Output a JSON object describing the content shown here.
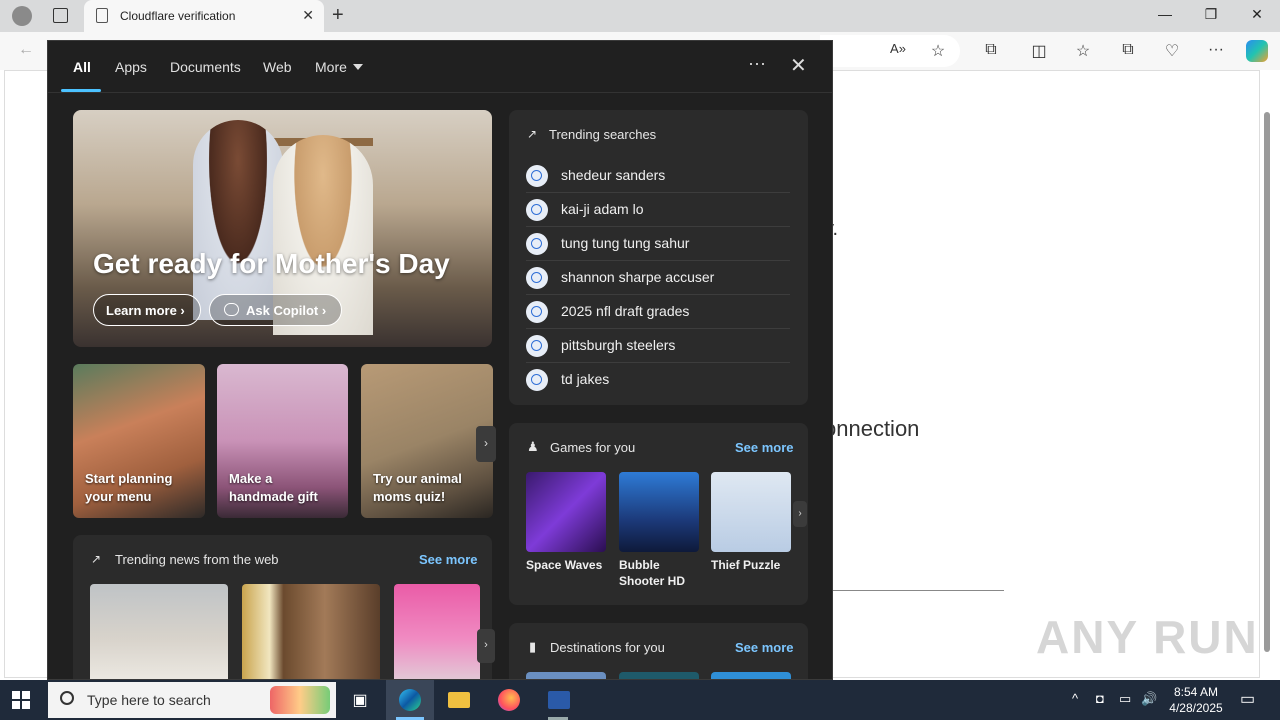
{
  "browser": {
    "tab_title": "Cloudflare verification",
    "tab_close": "✕",
    "new_tab": "+",
    "win_min": "—",
    "win_restore": "❐",
    "win_close": "✕",
    "nav_back": "←",
    "nav_read_aloud": "A»",
    "nav_favorite": "☆",
    "nav_extensions": "⧉",
    "nav_split": "◫",
    "nav_favorites": "☆",
    "nav_collections": "⧉",
    "nav_browser_essentials": "♡",
    "nav_menu": "···"
  },
  "page_behind": {
    "text1": "y.",
    "text2": "onnection",
    "watermark": "ANY RUN"
  },
  "panel": {
    "tabs": [
      {
        "label": "All"
      },
      {
        "label": "Apps"
      },
      {
        "label": "Documents"
      },
      {
        "label": "Web"
      },
      {
        "label": "More"
      }
    ],
    "ellipsis": "···",
    "close": "✕",
    "hero": {
      "title": "Get ready for Mother's Day",
      "learn_more": "Learn more ›",
      "ask_copilot": "Ask Copilot ›"
    },
    "cards": [
      {
        "label_line1": "Start planning",
        "label_line2": "your menu"
      },
      {
        "label_line1": "Make a",
        "label_line2": "handmade gift"
      },
      {
        "label_line1": "Try our animal",
        "label_line2": "moms quiz!"
      }
    ],
    "card_arrow": "›",
    "news": {
      "header": "Trending news from the web",
      "see_more": "See more",
      "arrow": "›"
    },
    "trending": {
      "header": "Trending searches",
      "items": [
        "shedeur sanders",
        "kai-ji adam lo",
        "tung tung tung sahur",
        "shannon sharpe accuser",
        "2025 nfl draft grades",
        "pittsburgh steelers",
        "td jakes"
      ]
    },
    "games": {
      "header": "Games for you",
      "see_more": "See more",
      "items": [
        {
          "name": "Space Waves"
        },
        {
          "name": "Bubble Shooter HD"
        },
        {
          "name": "Thief Puzzle"
        }
      ],
      "arrow": "›"
    },
    "destinations": {
      "header": "Destinations for you",
      "see_more": "See more"
    }
  },
  "taskbar": {
    "search_placeholder": "Type here to search",
    "time": "8:54 AM",
    "date": "4/28/2025",
    "tray_chevron": "^",
    "tray_volume": "🔊",
    "tray_notifications": "▭"
  },
  "colors": {
    "panel_bg": "#202020",
    "card_bg": "#2b2b2b",
    "accent": "#4cc2ff",
    "link": "#7cc6ff",
    "taskbar": "#1f2a3a"
  }
}
